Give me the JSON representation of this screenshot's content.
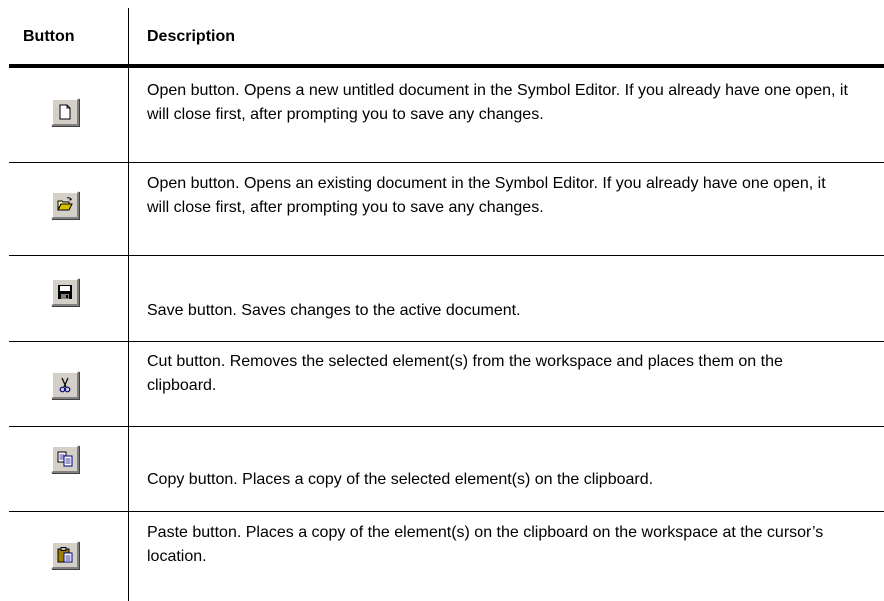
{
  "header": {
    "button_col": "Button",
    "description_col": "Description"
  },
  "rows": [
    {
      "icon": "new-document-icon",
      "description": "Open button. Opens a new untitled document in the Symbol Editor. If you already have one open, it will close first, after prompting you to save any changes."
    },
    {
      "icon": "open-folder-icon",
      "description": "Open button. Opens an existing document in the Symbol Editor. If you already have one open, it will close first, after prompting you to save any changes."
    },
    {
      "icon": "save-floppy-icon",
      "description": "Save button. Saves changes to the active document."
    },
    {
      "icon": "scissors-icon",
      "description": "Cut button. Removes the selected element(s) from the workspace and places them on the clipboard."
    },
    {
      "icon": "copy-icon",
      "description": "Copy button. Places a copy of the selected element(s) on the clipboard."
    },
    {
      "icon": "paste-clipboard-icon",
      "description": "Paste button. Places a copy of the element(s) on the clipboard on the workspace at the cursor’s location."
    }
  ]
}
